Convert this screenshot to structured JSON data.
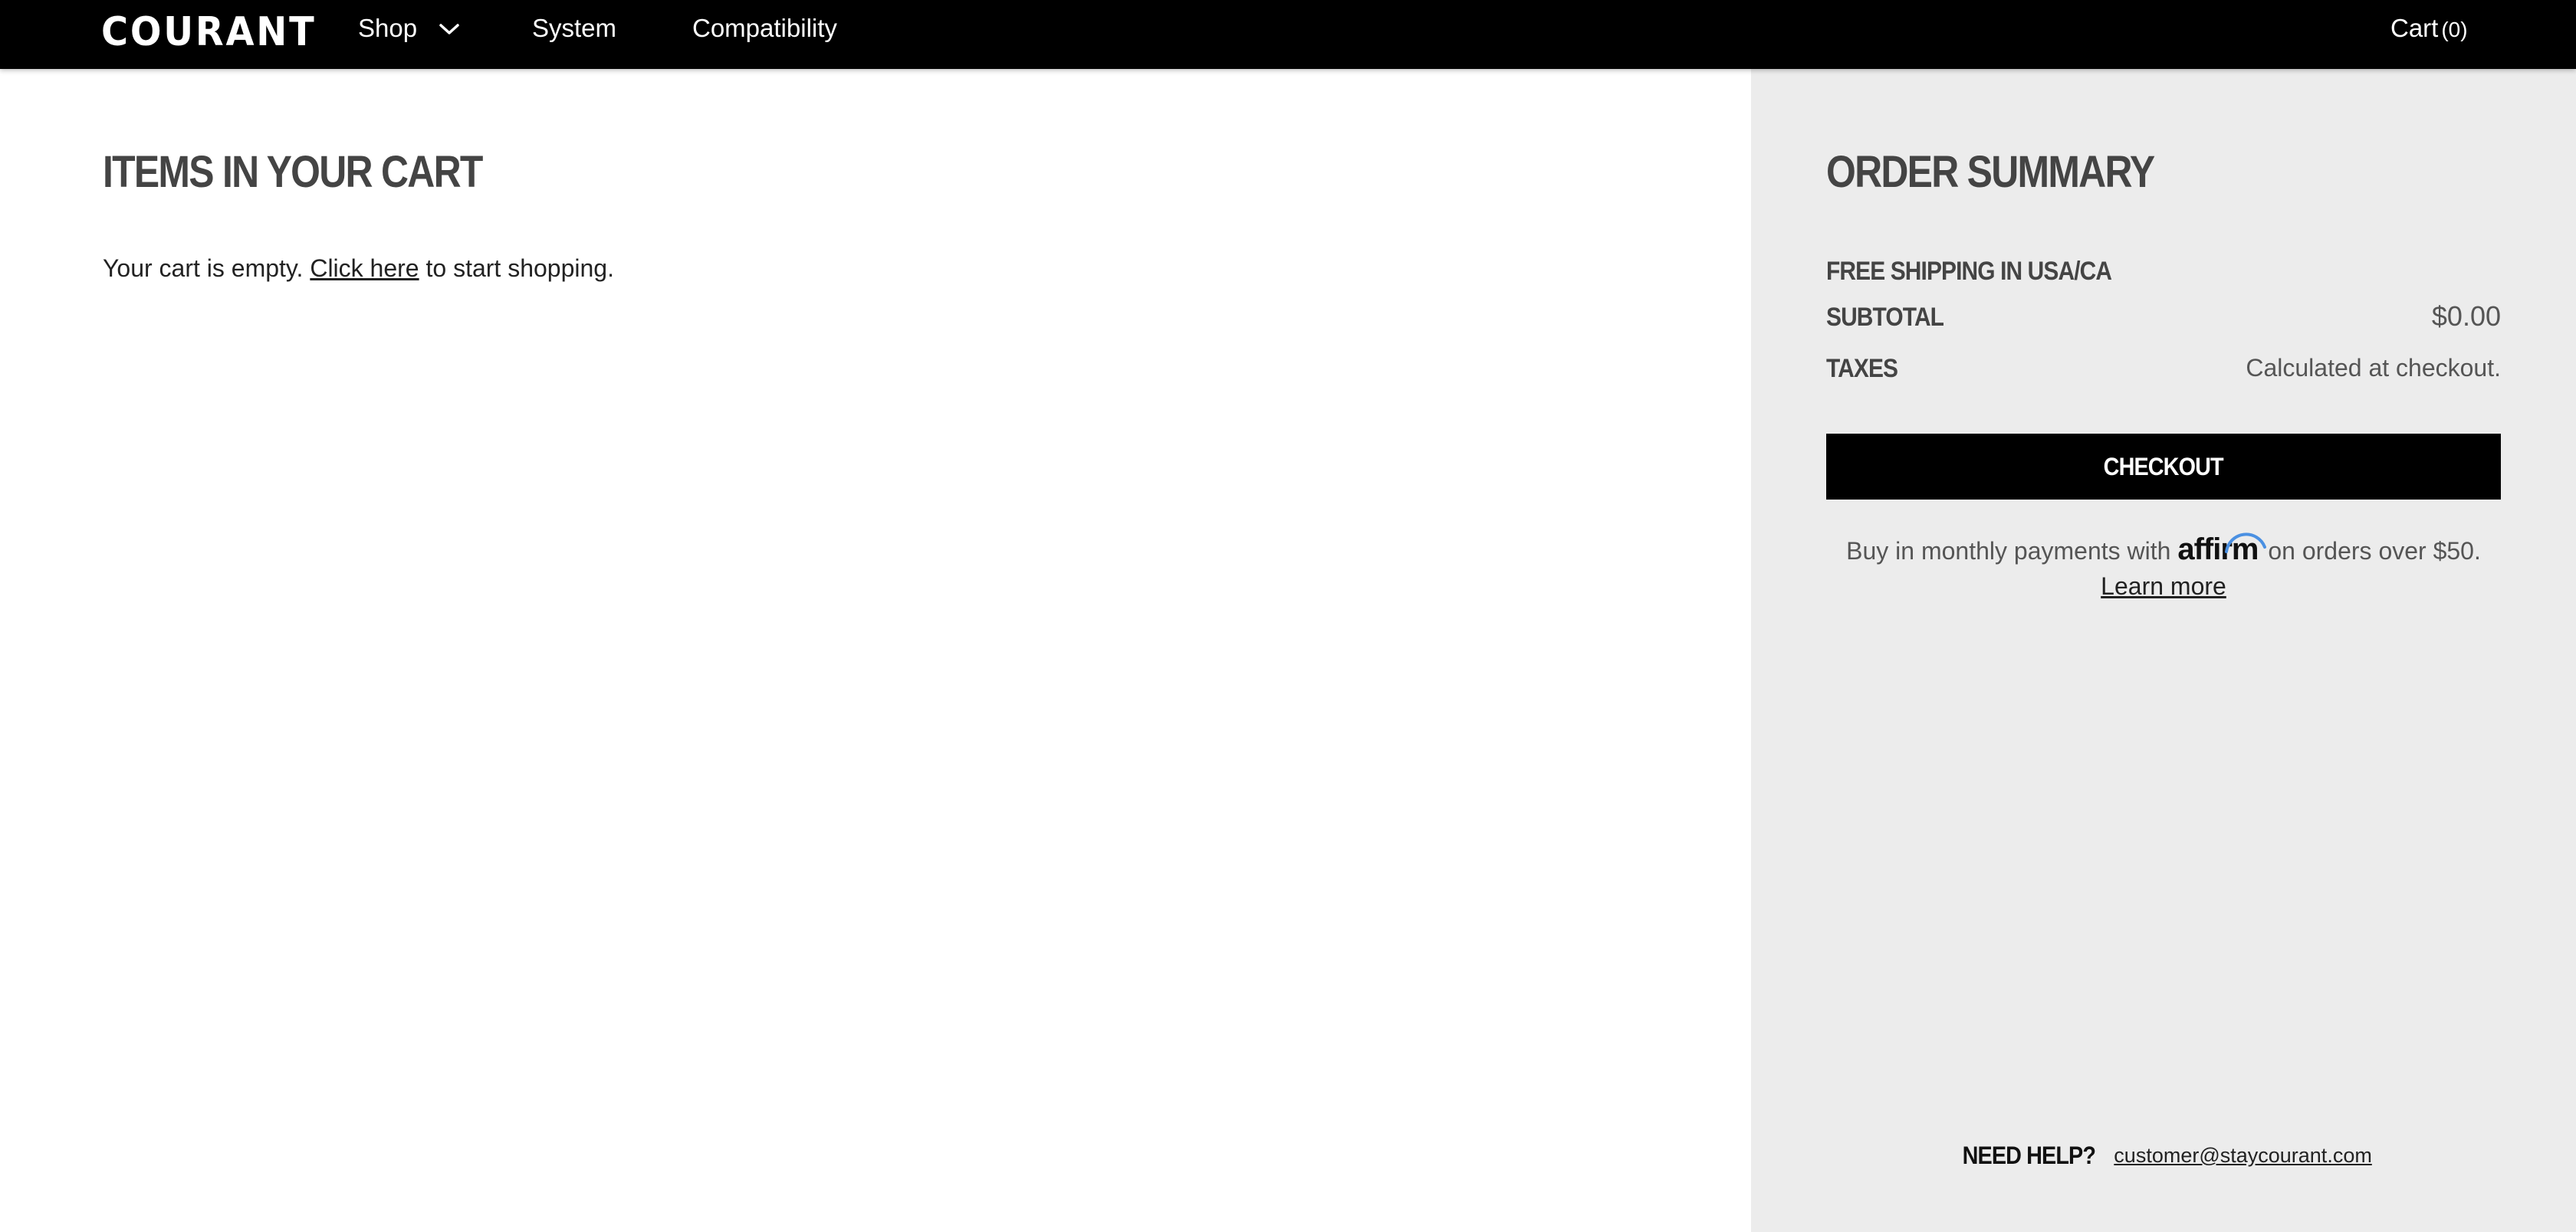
{
  "header": {
    "logo": "COURANT",
    "nav": {
      "shop": "Shop",
      "system": "System",
      "compatibility": "Compatibility"
    },
    "cart_label": "Cart",
    "cart_count": "(0)"
  },
  "cart": {
    "heading": "ITEMS IN YOUR CART",
    "empty_prefix": "Your cart is empty.",
    "click_here": "Click here",
    "empty_suffix": "to start shopping."
  },
  "summary": {
    "heading": "ORDER SUMMARY",
    "shipping": "FREE SHIPPING IN USA/CA",
    "subtotal_label": "SUBTOTAL",
    "subtotal_value": "$0.00",
    "taxes_label": "TAXES",
    "taxes_value": "Calculated at checkout.",
    "checkout": "CHECKOUT",
    "affirm_prefix": "Buy in monthly payments with",
    "affirm_logo": "affirm",
    "affirm_suffix": "on orders over $50.",
    "learn_more": "Learn more",
    "help_label": "NEED HELP?",
    "help_email": "customer@staycourant.com"
  },
  "colors": {
    "header_bg": "#000000",
    "summary_bg": "#ececec",
    "heading_text": "#444444",
    "checkout_bg": "#000000",
    "affirm_accent": "#4a90e2"
  },
  "icons": {
    "shop_menu": "chevron-down-icon",
    "affirm": "affirm-arc-icon"
  }
}
